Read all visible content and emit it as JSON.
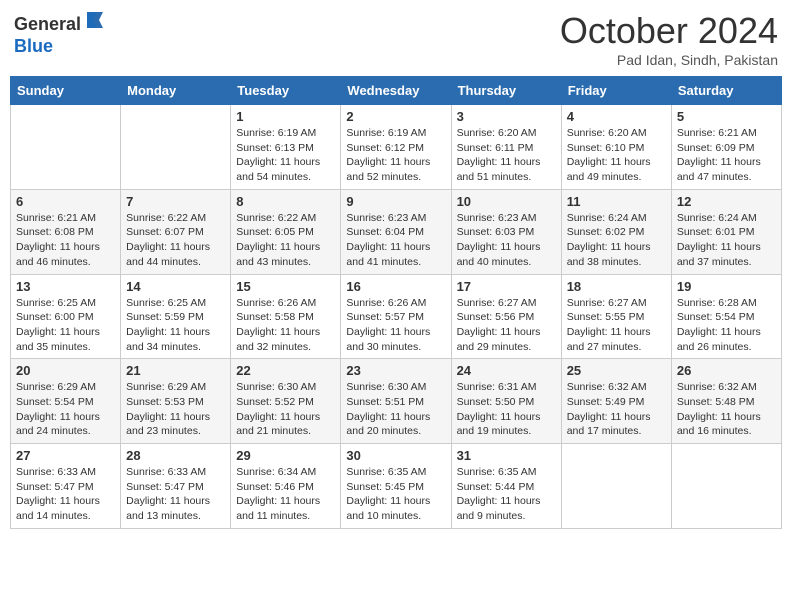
{
  "header": {
    "logo_line1": "General",
    "logo_line2": "Blue",
    "month_title": "October 2024",
    "location": "Pad Idan, Sindh, Pakistan"
  },
  "weekdays": [
    "Sunday",
    "Monday",
    "Tuesday",
    "Wednesday",
    "Thursday",
    "Friday",
    "Saturday"
  ],
  "weeks": [
    [
      {
        "day": "",
        "sunrise": "",
        "sunset": "",
        "daylight": ""
      },
      {
        "day": "",
        "sunrise": "",
        "sunset": "",
        "daylight": ""
      },
      {
        "day": "1",
        "sunrise": "Sunrise: 6:19 AM",
        "sunset": "Sunset: 6:13 PM",
        "daylight": "Daylight: 11 hours and 54 minutes."
      },
      {
        "day": "2",
        "sunrise": "Sunrise: 6:19 AM",
        "sunset": "Sunset: 6:12 PM",
        "daylight": "Daylight: 11 hours and 52 minutes."
      },
      {
        "day": "3",
        "sunrise": "Sunrise: 6:20 AM",
        "sunset": "Sunset: 6:11 PM",
        "daylight": "Daylight: 11 hours and 51 minutes."
      },
      {
        "day": "4",
        "sunrise": "Sunrise: 6:20 AM",
        "sunset": "Sunset: 6:10 PM",
        "daylight": "Daylight: 11 hours and 49 minutes."
      },
      {
        "day": "5",
        "sunrise": "Sunrise: 6:21 AM",
        "sunset": "Sunset: 6:09 PM",
        "daylight": "Daylight: 11 hours and 47 minutes."
      }
    ],
    [
      {
        "day": "6",
        "sunrise": "Sunrise: 6:21 AM",
        "sunset": "Sunset: 6:08 PM",
        "daylight": "Daylight: 11 hours and 46 minutes."
      },
      {
        "day": "7",
        "sunrise": "Sunrise: 6:22 AM",
        "sunset": "Sunset: 6:07 PM",
        "daylight": "Daylight: 11 hours and 44 minutes."
      },
      {
        "day": "8",
        "sunrise": "Sunrise: 6:22 AM",
        "sunset": "Sunset: 6:05 PM",
        "daylight": "Daylight: 11 hours and 43 minutes."
      },
      {
        "day": "9",
        "sunrise": "Sunrise: 6:23 AM",
        "sunset": "Sunset: 6:04 PM",
        "daylight": "Daylight: 11 hours and 41 minutes."
      },
      {
        "day": "10",
        "sunrise": "Sunrise: 6:23 AM",
        "sunset": "Sunset: 6:03 PM",
        "daylight": "Daylight: 11 hours and 40 minutes."
      },
      {
        "day": "11",
        "sunrise": "Sunrise: 6:24 AM",
        "sunset": "Sunset: 6:02 PM",
        "daylight": "Daylight: 11 hours and 38 minutes."
      },
      {
        "day": "12",
        "sunrise": "Sunrise: 6:24 AM",
        "sunset": "Sunset: 6:01 PM",
        "daylight": "Daylight: 11 hours and 37 minutes."
      }
    ],
    [
      {
        "day": "13",
        "sunrise": "Sunrise: 6:25 AM",
        "sunset": "Sunset: 6:00 PM",
        "daylight": "Daylight: 11 hours and 35 minutes."
      },
      {
        "day": "14",
        "sunrise": "Sunrise: 6:25 AM",
        "sunset": "Sunset: 5:59 PM",
        "daylight": "Daylight: 11 hours and 34 minutes."
      },
      {
        "day": "15",
        "sunrise": "Sunrise: 6:26 AM",
        "sunset": "Sunset: 5:58 PM",
        "daylight": "Daylight: 11 hours and 32 minutes."
      },
      {
        "day": "16",
        "sunrise": "Sunrise: 6:26 AM",
        "sunset": "Sunset: 5:57 PM",
        "daylight": "Daylight: 11 hours and 30 minutes."
      },
      {
        "day": "17",
        "sunrise": "Sunrise: 6:27 AM",
        "sunset": "Sunset: 5:56 PM",
        "daylight": "Daylight: 11 hours and 29 minutes."
      },
      {
        "day": "18",
        "sunrise": "Sunrise: 6:27 AM",
        "sunset": "Sunset: 5:55 PM",
        "daylight": "Daylight: 11 hours and 27 minutes."
      },
      {
        "day": "19",
        "sunrise": "Sunrise: 6:28 AM",
        "sunset": "Sunset: 5:54 PM",
        "daylight": "Daylight: 11 hours and 26 minutes."
      }
    ],
    [
      {
        "day": "20",
        "sunrise": "Sunrise: 6:29 AM",
        "sunset": "Sunset: 5:54 PM",
        "daylight": "Daylight: 11 hours and 24 minutes."
      },
      {
        "day": "21",
        "sunrise": "Sunrise: 6:29 AM",
        "sunset": "Sunset: 5:53 PM",
        "daylight": "Daylight: 11 hours and 23 minutes."
      },
      {
        "day": "22",
        "sunrise": "Sunrise: 6:30 AM",
        "sunset": "Sunset: 5:52 PM",
        "daylight": "Daylight: 11 hours and 21 minutes."
      },
      {
        "day": "23",
        "sunrise": "Sunrise: 6:30 AM",
        "sunset": "Sunset: 5:51 PM",
        "daylight": "Daylight: 11 hours and 20 minutes."
      },
      {
        "day": "24",
        "sunrise": "Sunrise: 6:31 AM",
        "sunset": "Sunset: 5:50 PM",
        "daylight": "Daylight: 11 hours and 19 minutes."
      },
      {
        "day": "25",
        "sunrise": "Sunrise: 6:32 AM",
        "sunset": "Sunset: 5:49 PM",
        "daylight": "Daylight: 11 hours and 17 minutes."
      },
      {
        "day": "26",
        "sunrise": "Sunrise: 6:32 AM",
        "sunset": "Sunset: 5:48 PM",
        "daylight": "Daylight: 11 hours and 16 minutes."
      }
    ],
    [
      {
        "day": "27",
        "sunrise": "Sunrise: 6:33 AM",
        "sunset": "Sunset: 5:47 PM",
        "daylight": "Daylight: 11 hours and 14 minutes."
      },
      {
        "day": "28",
        "sunrise": "Sunrise: 6:33 AM",
        "sunset": "Sunset: 5:47 PM",
        "daylight": "Daylight: 11 hours and 13 minutes."
      },
      {
        "day": "29",
        "sunrise": "Sunrise: 6:34 AM",
        "sunset": "Sunset: 5:46 PM",
        "daylight": "Daylight: 11 hours and 11 minutes."
      },
      {
        "day": "30",
        "sunrise": "Sunrise: 6:35 AM",
        "sunset": "Sunset: 5:45 PM",
        "daylight": "Daylight: 11 hours and 10 minutes."
      },
      {
        "day": "31",
        "sunrise": "Sunrise: 6:35 AM",
        "sunset": "Sunset: 5:44 PM",
        "daylight": "Daylight: 11 hours and 9 minutes."
      },
      {
        "day": "",
        "sunrise": "",
        "sunset": "",
        "daylight": ""
      },
      {
        "day": "",
        "sunrise": "",
        "sunset": "",
        "daylight": ""
      }
    ]
  ]
}
